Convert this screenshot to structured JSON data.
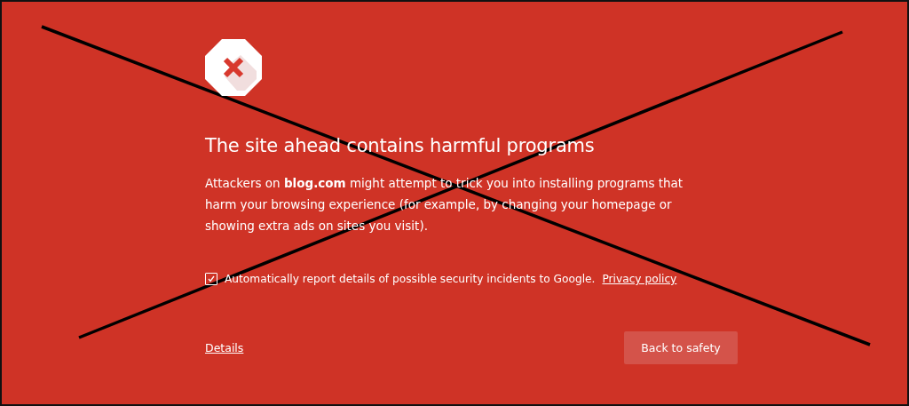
{
  "heading": "The site ahead contains harmful programs",
  "message": "Attackers on **blog.com** might attempt to trick you into installing programs that harm your browsing experience (for example, by changing your homepage or showing extra ads on sites you visit).",
  "report": {
    "checked": true,
    "label": "Automatically report details of possible security incidents to Google.",
    "link": "Privacy policy"
  },
  "details_link": "Details",
  "primary_button": "Back to safety"
}
